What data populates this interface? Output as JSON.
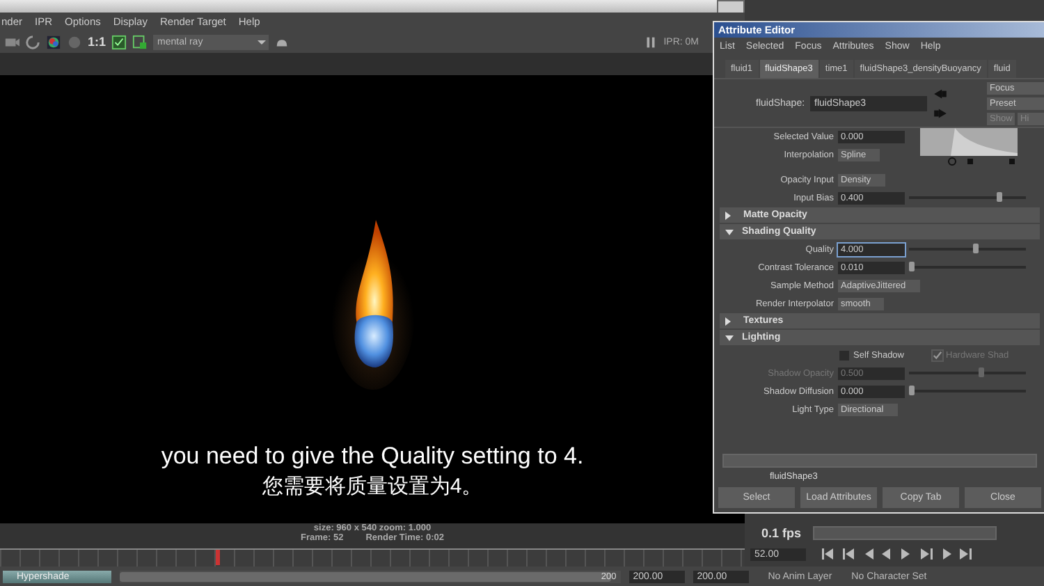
{
  "render_view": {
    "menu": [
      "nder",
      "IPR",
      "Options",
      "Display",
      "Render Target",
      "Help"
    ],
    "toolbar": {
      "ratio": "1:1",
      "renderer": "mental ray",
      "ipr_memory": "IPR: 0M"
    },
    "info": {
      "size": "size: 960 x 540 zoom: 1.000",
      "frame": "Frame: 52",
      "render_time": "Render Time: 0:02"
    }
  },
  "attribute_editor": {
    "title": "Attribute Editor",
    "menu": [
      "List",
      "Selected",
      "Focus",
      "Attributes",
      "Show",
      "Help"
    ],
    "tabs": [
      {
        "label": "fluid1",
        "selected": false
      },
      {
        "label": "fluidShape3",
        "selected": true
      },
      {
        "label": "time1",
        "selected": false
      },
      {
        "label": "fluidShape3_densityBuoyancy",
        "selected": false
      },
      {
        "label": "fluid",
        "selected": false
      }
    ],
    "node_label": "fluidShape:",
    "node_name": "fluidShape3",
    "side_buttons": [
      "Focus",
      "Preset",
      "Show",
      "Hi"
    ],
    "rows": [
      {
        "kind": "ramp",
        "label": "Selected Value",
        "value": "0.000",
        "label_2": "Interpolation",
        "value_2": "Spline"
      },
      {
        "kind": "dropdown",
        "label": "Opacity Input",
        "value": "Density"
      },
      {
        "kind": "slider",
        "label": "Input Bias",
        "value": "0.400",
        "level": 0.75,
        "disabled": false
      },
      {
        "kind": "section",
        "label": "Matte Opacity",
        "expanded": false
      },
      {
        "kind": "section",
        "label": "Shading Quality",
        "expanded": true
      },
      {
        "kind": "slider",
        "label": "Quality",
        "value": "4.000",
        "level": 0.55,
        "disabled": false
      },
      {
        "kind": "slider",
        "label": "Contrast Tolerance",
        "value": "0.010",
        "level": 0.0,
        "disabled": false
      },
      {
        "kind": "dropdown",
        "label": "Sample Method",
        "value": "AdaptiveJittered"
      },
      {
        "kind": "dropdown",
        "label": "Render Interpolator",
        "value": "smooth"
      },
      {
        "kind": "section",
        "label": "Textures",
        "expanded": false
      },
      {
        "kind": "section",
        "label": "Lighting",
        "expanded": true
      },
      {
        "kind": "checkboxes",
        "items": [
          {
            "label": "Self Shadow",
            "checked": false,
            "disabled": false
          },
          {
            "label": "Hardware Shad",
            "checked": true,
            "disabled": true
          }
        ]
      },
      {
        "kind": "slider",
        "label": "Shadow Opacity",
        "value": "0.500",
        "level": 0.6,
        "disabled": true
      },
      {
        "kind": "slider",
        "label": "Shadow Diffusion",
        "value": "0.000",
        "level": 0.0,
        "disabled": false
      },
      {
        "kind": "dropdown",
        "label": "Light Type",
        "value": "Directional"
      }
    ],
    "notes": "fluidShape3",
    "buttons": [
      "Select",
      "Load Attributes",
      "Copy Tab",
      "Close"
    ]
  },
  "subtitles": [
    "you need to give the Quality setting to 4.",
    "您需要将质量设置为4。"
  ],
  "timeline": {
    "time_slider": {
      "level": 0.29
    },
    "range_slider": {
      "level": 0.98
    },
    "fps": "0.1 fps",
    "current_frame": "52.00",
    "range_field": "200",
    "start": "200.00",
    "end": "200.00",
    "anim_layer": "No Anim Layer",
    "character_set": "No Character Set"
  },
  "taskbar": {
    "item": "Hypershade"
  }
}
